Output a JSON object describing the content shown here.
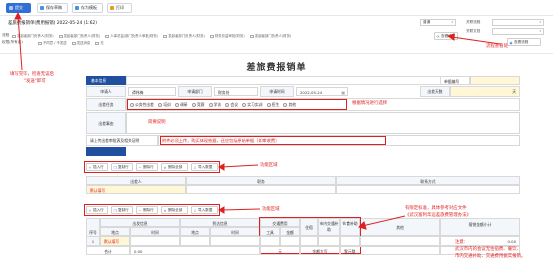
{
  "toolbar": {
    "submit": "提交",
    "save_draft": "保存草稿",
    "save_template": "存为模板",
    "print": "打印",
    "submit_color": "#2f6fd6"
  },
  "flow": {
    "title": "差旅费报销单(费用报销) 2022-05-24 (1:62)",
    "urgency": "普通",
    "related_process_label": "关联流程",
    "related_doc_label": "关联文档",
    "nodes_row1": [
      "发起者部门负责人(财务)",
      "发起者部门负责人(财务)",
      "人事总监/部门负责人审批(财务)",
      "发起者部门负责人(财务)",
      "财务总监审批(财务)",
      "发起者部门负责人(财务)"
    ],
    "nodes_row2": [
      "不同意 / 不发送",
      "发送消息",
      "无"
    ],
    "view_flow": "查看流程",
    "flow_label": "流程",
    "view_flow_tag": "查看流程",
    "permission_label": "权限(所有者)"
  },
  "annotations": {
    "fill_complete": "填写完毕，检查无误后",
    "click_send": "\"发送\"即可",
    "flow_view": "流程查看处",
    "brief": "简要说明",
    "select_info": "根据情况进行选择",
    "attachment_note": "附件必须上传，购买体现依据，还应包括原始单据（如审收费）",
    "func_area_1": "功能区域",
    "func_area_2": "功能区域",
    "per_standard": "有限定标准，具体参考对应文件",
    "standard_doc": "《武汉富利华远差旅费管理办法》",
    "note_title": "注意:",
    "note_body1": "武汉市内的会议无住宿费、餐饮、",
    "note_body2": "市内交通补助、交通费用据实报销。",
    "auto_fill": "默认填写"
  },
  "form": {
    "title": "差旅费报销单",
    "basic_info": "基本信息",
    "serial_label": "单据编号",
    "applicant_label": "申请人",
    "applicant_value": "谭炜梅",
    "dept_label": "申请部门",
    "dept_value": "财务处",
    "date_label": "申请时间",
    "date_value": "2022-05-24",
    "total_label": "出差天数",
    "total_value": "天",
    "task_label": "出差任务",
    "tasks": [
      "公务性出差",
      "培训",
      "调研",
      "竞赛",
      "学访",
      "会议",
      "实习实训",
      "招生",
      "其他"
    ],
    "reason_label": "出差事由",
    "upload_label": "请上传出差审批表及相关证明",
    "traveler_section": "出差人员",
    "traveler_col": "出差人",
    "job_col": "职务",
    "contact_col": "联系方式"
  },
  "actions": {
    "insert": "插入行",
    "copy": "复制行",
    "delete": "删除行",
    "delete_all": "删除全部",
    "import": "导入数据"
  },
  "detail_table": {
    "seq": "序号",
    "departure": "出发信息",
    "arrival": "到达信息",
    "place": "地点",
    "time": "时间",
    "traffic_fee": "交通费用",
    "tool": "工具",
    "amount": "金额",
    "lodging": "住宿",
    "city_traffic": "市内交通补助",
    "meal": "伙食补助",
    "other": "其他",
    "reimb_total": "报销金额小计",
    "row1_seq": "1",
    "row1_place": "默认填写",
    "sum_label": "合计",
    "sum_value": "0.00",
    "yuan": "元",
    "amount_upper": "金额大写",
    "zero": "零元整",
    "sum_zero": "0.00"
  }
}
